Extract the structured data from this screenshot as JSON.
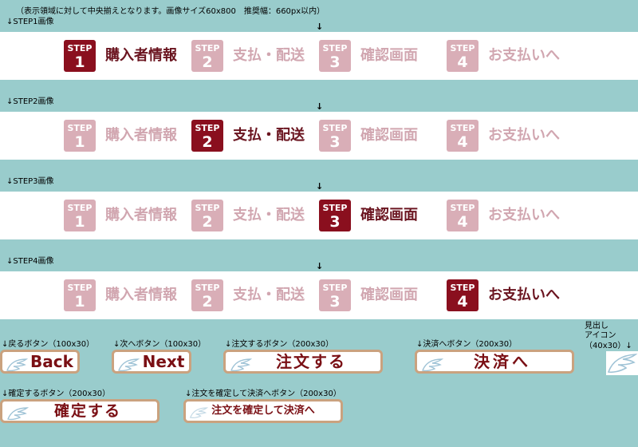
{
  "top_note": "（表示領域に対して中央揃えとなります。画像サイズ60x800　推奨幅：660px以内）",
  "center_arrow": "↓",
  "sections": [
    {
      "caption": "↓STEP1画像",
      "active": 1
    },
    {
      "caption": "↓STEP2画像",
      "active": 2
    },
    {
      "caption": "↓STEP3画像",
      "active": 3
    },
    {
      "caption": "↓STEP4画像",
      "active": 4
    }
  ],
  "steps": [
    {
      "word": "STEP",
      "number": "1",
      "label": "購入者情報"
    },
    {
      "word": "STEP",
      "number": "2",
      "label": "支払・配送"
    },
    {
      "word": "STEP",
      "number": "3",
      "label": "確認画面"
    },
    {
      "word": "STEP",
      "number": "4",
      "label": "お支払いへ"
    }
  ],
  "buttons": {
    "back": {
      "caption": "↓戻るボタン（100x30）",
      "label": "Back"
    },
    "next": {
      "caption": "↓次へボタン（100x30）",
      "label": "Next"
    },
    "order": {
      "caption": "↓注文するボタン（200x30）",
      "label": "注文する"
    },
    "payment": {
      "caption": "↓決済へボタン（200x30）",
      "label": "決済へ"
    },
    "heading_icon": {
      "caption_line1": "見出し",
      "caption_line2": "アイコン",
      "caption_line3": "（40x30）↓"
    },
    "confirm": {
      "caption": "↓確定するボタン（200x30）",
      "label": "確定する"
    },
    "confirm_to_payment": {
      "caption": "↓注文を確定して決済へボタン（200x30）",
      "label": "注文を確定して決済へ"
    }
  },
  "colors": {
    "background": "#99cccc",
    "active_step": "#8a0f1e",
    "inactive_step": "#d9aeb7",
    "button_border": "#caa27f",
    "button_text": "#7a0f14"
  }
}
